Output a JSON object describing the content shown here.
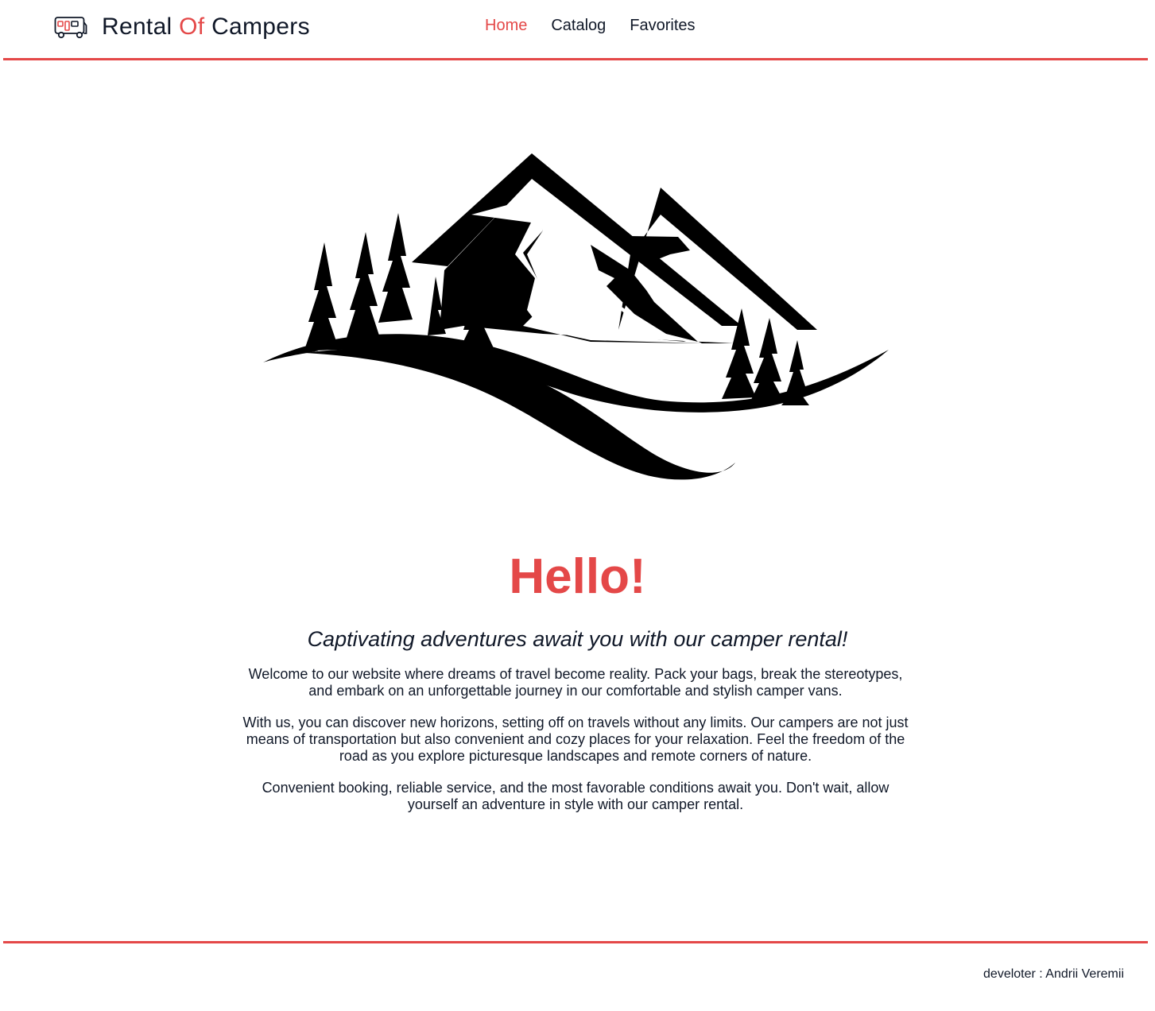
{
  "header": {
    "logo_icon": "camper-van-icon",
    "logo_part1": "Rental ",
    "logo_accent": "Of",
    "logo_part2": " Campers",
    "nav": [
      {
        "label": "Home",
        "active": true
      },
      {
        "label": "Catalog",
        "active": false
      },
      {
        "label": "Favorites",
        "active": false
      }
    ]
  },
  "hero": {
    "image": "mountains-forest-logo-illustration",
    "title": "Hello!",
    "subtitle": "Captivating adventures await you with our camper rental!",
    "paragraphs": [
      "Welcome to our website where dreams of travel become reality. Pack your bags, break the stereotypes, and embark on an unforgettable journey in our comfortable and stylish camper vans.",
      "With us, you can discover new horizons, setting off on travels without any limits. Our campers are not just means of transportation but also convenient and cozy places for your relaxation. Feel the freedom of the road as you explore picturesque landscapes and remote corners of nature.",
      "Convenient booking, reliable service, and the most favorable conditions await you. Don't wait, allow yourself an adventure in style with our camper rental."
    ]
  },
  "footer": {
    "developer": "develoter : Andrii Veremii"
  },
  "colors": {
    "accent": "#e44848",
    "text": "#101828",
    "background": "#ffffff"
  }
}
